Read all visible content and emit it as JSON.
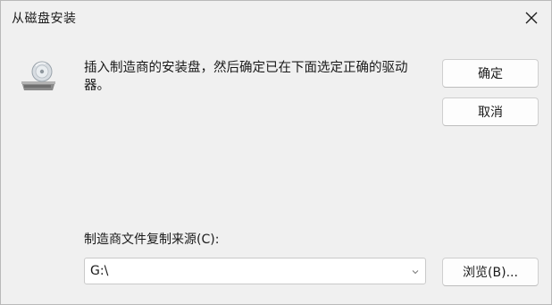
{
  "window": {
    "title": "从磁盘安装",
    "close_icon": "close-icon"
  },
  "main": {
    "icon": "disk-drive-icon",
    "message": "插入制造商的安装盘，然后确定已在下面选定正确的驱动器。"
  },
  "buttons": {
    "ok_label": "确定",
    "cancel_label": "取消",
    "browse_label": "浏览(B)..."
  },
  "source": {
    "label": "制造商文件复制来源(C):",
    "value": "G:\\"
  }
}
